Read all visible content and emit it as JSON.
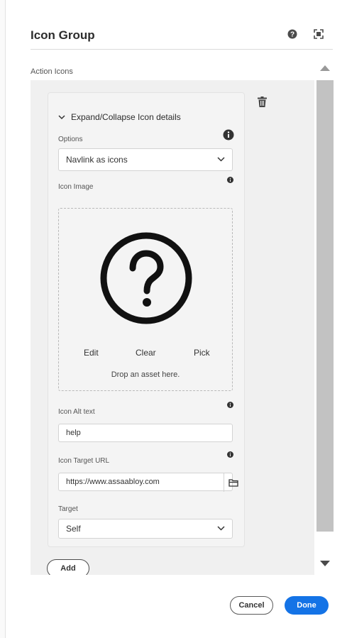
{
  "dialog": {
    "title": "Icon Group",
    "help_icon": "help-icon",
    "fullscreen_icon": "fullscreen-icon"
  },
  "section": {
    "label": "Action Icons"
  },
  "item": {
    "expand_label": "Expand/Collapse Icon details",
    "options": {
      "label": "Options",
      "value": "Navlink as icons"
    },
    "icon_image": {
      "label": "Icon Image",
      "actions": [
        "Edit",
        "Clear",
        "Pick"
      ],
      "drop_hint": "Drop an asset here.",
      "preview_icon": "question-circle-icon"
    },
    "alt_text": {
      "label": "Icon Alt text",
      "value": "help"
    },
    "target_url": {
      "label": "Icon Target URL",
      "value": "https://www.assaabloy.com"
    },
    "target": {
      "label": "Target",
      "value": "Self"
    }
  },
  "add_label": "Add",
  "footer": {
    "cancel_label": "Cancel",
    "done_label": "Done"
  },
  "colors": {
    "primary": "#1473e6",
    "panel": "#f0f0f0",
    "scrollbar": "#c2c2c2"
  }
}
